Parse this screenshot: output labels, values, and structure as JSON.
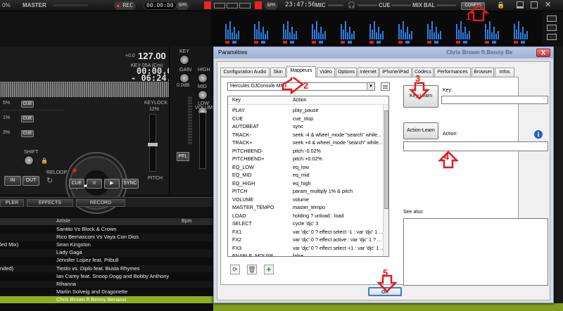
{
  "topbar": {
    "pct": "0%",
    "master": "MASTER",
    "rec": "REC",
    "rec_time": "00:00:00",
    "bpm1": "BPM",
    "bpm2": "BPM",
    "clock": "23:47:56",
    "mic": "MIC",
    "cue": "CUE",
    "mix": "MIX",
    "bal": "BAL",
    "config": "CONFIG"
  },
  "deck": {
    "pitch_offset": "+0.0",
    "bpm_value": "127.00",
    "key": "KEY 05A (Cm)",
    "elapsed": "00:00.0",
    "remaining": "- 06:24.6",
    "gain": "0.0dB",
    "keylock": "KEYLOCK",
    "keylock_pct": "12%",
    "volume": "VOLUME",
    "shift": "SHIFT",
    "reloop": "RELOOP",
    "in_label": "IN",
    "out_label": "OUT",
    "cue_label": "CUE",
    "sync_label": "SYNC",
    "pitch_label": "PITCH",
    "pfl_label": "PFL",
    "knob_labels": [
      "KEY",
      "GAIN",
      "HIGH",
      "MID",
      "LOW"
    ],
    "cue_slots": [
      "CUE",
      "CUE",
      "CUE"
    ],
    "row_pcts": [
      "5%",
      "1%",
      "3%"
    ]
  },
  "tabs": [
    "PLER",
    "EFFECTS",
    "RECORD"
  ],
  "browser": {
    "col_artist": "Artiste",
    "col_bpm": "Bpm",
    "rows": [
      {
        "left": "",
        "artist": "Santito Vs Block & Crown"
      },
      {
        "left": "",
        "artist": "Rico Bernasconi Vs Vaya Con Dios"
      },
      {
        "left": "led Mix)",
        "artist": "Sean Kingston"
      },
      {
        "left": "",
        "artist": "Lady Gaga"
      },
      {
        "left": "",
        "artist": "Jennifer Lopez feat. Pitbull"
      },
      {
        "left": "nded)",
        "artist": "Tiesto vs. Diplo feat. Busta Rhymes"
      },
      {
        "left": "",
        "artist": "Ian Carey feat. Snoop Dogg and Bobby Anthony"
      },
      {
        "left": "",
        "artist": "Rihanna"
      },
      {
        "left": "",
        "artist": "Martin Solveig and Dragonette"
      },
      {
        "left": "",
        "artist": "Chris Brown ft Benny Benassi"
      }
    ]
  },
  "dialog": {
    "title": "Paramètres",
    "ghost_title": "Chris Brown ft Benny Be",
    "close": "X",
    "tabs": [
      "Configuration Audio",
      "Skin",
      "Mappeurs",
      "Video",
      "Options",
      "Internet",
      "iPhone/iPad",
      "Codecs",
      "Performances",
      "Browser",
      "Infos"
    ],
    "active_tab": "Mappeurs",
    "mapper_select": "Hercules DJConsole MP3",
    "list_header_key": "Key",
    "list_header_action": "Action",
    "mappings": [
      {
        "key": "PLAY",
        "action": "play_pause"
      },
      {
        "key": "CUE",
        "action": "cue_stop"
      },
      {
        "key": "AUTOBEAT",
        "action": "sync"
      },
      {
        "key": "TRACK-",
        "action": "seek -4 & wheel_mode \"search\" while..."
      },
      {
        "key": "TRACK+",
        "action": "seek +4 & wheel_mode \"search\" while..."
      },
      {
        "key": "PITCHBEND-",
        "action": "pitch -0.02%"
      },
      {
        "key": "PITCHBEND+",
        "action": "pitch +0.02%"
      },
      {
        "key": "EQ_LOW",
        "action": "eq_low"
      },
      {
        "key": "EQ_MID",
        "action": "eq_mid"
      },
      {
        "key": "EQ_HIGH",
        "action": "eq_high"
      },
      {
        "key": "PITCH",
        "action": "param_multiply 1% & pitch"
      },
      {
        "key": "VOLUME",
        "action": "volume"
      },
      {
        "key": "MASTER_TEMPO",
        "action": "master_tempo"
      },
      {
        "key": "LOAD",
        "action": "holding ? unload : load"
      },
      {
        "key": "SELECT",
        "action": "cycle 'djc' 3"
      },
      {
        "key": "FX1",
        "action": "var 'djc' 0 ? effect select -1 : var 'djc' 1 ..."
      },
      {
        "key": "FX2",
        "action": "var 'djc' 0 ? effect active : var 'djc' 1 ? ..."
      },
      {
        "key": "FX3",
        "action": "var 'djc' 0 ? effect select +1 : var 'djc' 1 ..."
      },
      {
        "key": "ENABLE_MOUSE",
        "action": "false"
      }
    ],
    "key_learn": "Key-Learn",
    "key_label": "Key:",
    "action_learn": "Action-Learn",
    "action_label": "Action:",
    "info": "i",
    "see_also": "See also:",
    "ok": "OK"
  },
  "annotations": [
    "1",
    "2",
    "3",
    "4",
    "5"
  ],
  "colors": {
    "annotation": "#e21b1b",
    "selected_row": "#8fae1f",
    "sampler_blue": "#2d7de0",
    "sampler_red": "#e02020"
  }
}
